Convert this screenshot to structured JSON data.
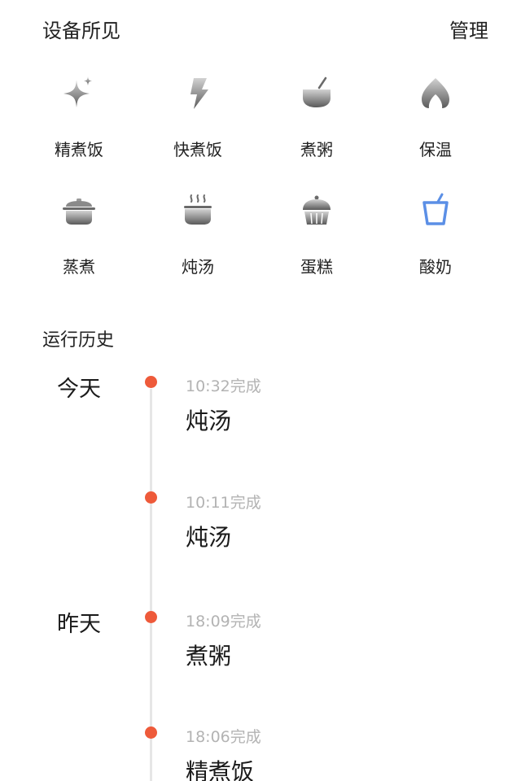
{
  "header": {
    "title": "设备所见",
    "manage_label": "管理"
  },
  "modes": [
    {
      "label": "精煮饭",
      "icon": "sparkle-icon"
    },
    {
      "label": "快煮饭",
      "icon": "lightning-icon"
    },
    {
      "label": "煮粥",
      "icon": "bowl-icon"
    },
    {
      "label": "保温",
      "icon": "flame-icon"
    },
    {
      "label": "蒸煮",
      "icon": "pot-icon"
    },
    {
      "label": "炖汤",
      "icon": "steam-pot-icon"
    },
    {
      "label": "蛋糕",
      "icon": "cake-icon"
    },
    {
      "label": "酸奶",
      "icon": "cup-icon"
    }
  ],
  "history": {
    "title": "运行历史",
    "days": [
      "今天",
      "昨天"
    ],
    "entries": [
      {
        "time": "10:32完成",
        "name": "炖汤"
      },
      {
        "time": "10:11完成",
        "name": "炖汤"
      },
      {
        "time": "18:09完成",
        "name": "煮粥"
      },
      {
        "time": "18:06完成",
        "name": "精煮饭"
      }
    ]
  },
  "colors": {
    "accent_dot": "#ee5a3a",
    "icon_gray_top": "#cfcfcf",
    "icon_gray_bottom": "#5f5f5f",
    "icon_blue": "#5b8fe6",
    "muted_text": "#b3b3b3"
  }
}
